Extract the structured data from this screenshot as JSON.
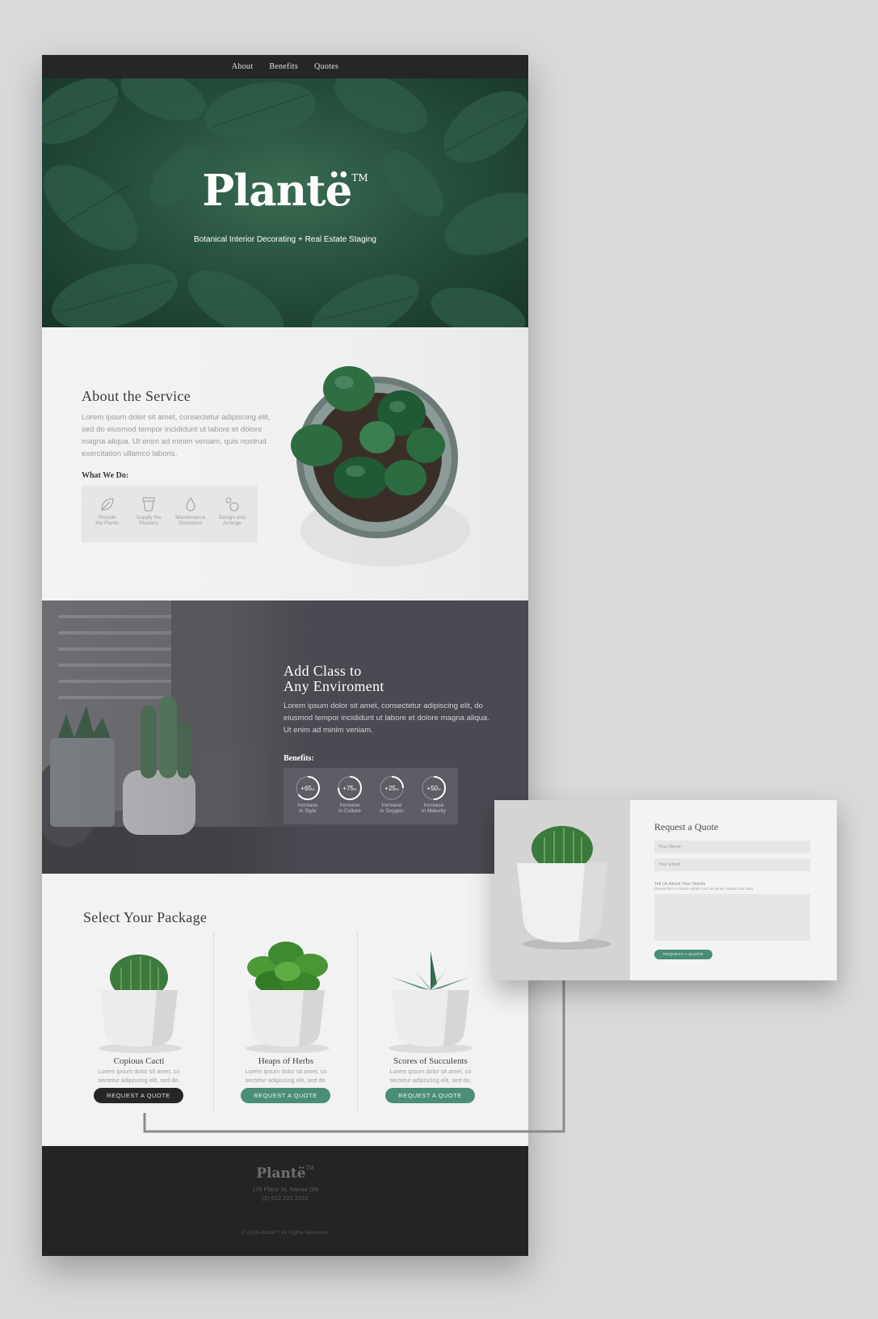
{
  "nav": {
    "items": [
      "About",
      "Benefits",
      "Quotes"
    ]
  },
  "hero": {
    "logo": "Plantë",
    "logo_mark": "TM",
    "tagline": "Botanical Interior Decorating + Real Estate Staging"
  },
  "about": {
    "title": "About the Service",
    "body": "Lorem ipsum dolor sit amet, consectetur adipiscing elit, sed do eiusmod tempor incididunt ut labore et dolore magna aliqua. Ut enim ad minim veniam, quis nostrud exercitation ullamco laboris.",
    "subtitle": "What We Do:",
    "services": [
      {
        "line1": "Provide",
        "line2": "the Plants",
        "icon": "leaf-icon"
      },
      {
        "line1": "Supply the",
        "line2": "Planters",
        "icon": "planter-icon"
      },
      {
        "line1": "Maintenance",
        "line2": "Directions",
        "icon": "water-drop-icon"
      },
      {
        "line1": "Design and",
        "line2": "Arrange",
        "icon": "arrange-icon"
      }
    ]
  },
  "classy": {
    "title_line1": "Add Class to",
    "title_line2": "Any Enviroment",
    "body": "Lorem ipsum dolor sit amet, consectetur adipiscing elit, do eiusmod tempor incididunt ut labore et dolore magna aliqua. Ut enim ad minim veniam.",
    "subtitle": "Benefits:",
    "benefits": [
      {
        "value": "+65",
        "unit": "%",
        "percent": 65,
        "line1": "Increase",
        "line2": "in Style"
      },
      {
        "value": "+75",
        "unit": "%",
        "percent": 75,
        "line1": "Increase",
        "line2": "in Culture"
      },
      {
        "value": "+25",
        "unit": "%",
        "percent": 25,
        "line1": "Increase",
        "line2": "in Oxygen"
      },
      {
        "value": "+50",
        "unit": "%",
        "percent": 50,
        "line1": "Increase",
        "line2": "in Maturity"
      }
    ]
  },
  "packages": {
    "title": "Select Your Package",
    "items": [
      {
        "name": "Copious Cacti",
        "desc1": "Lorem ipsum dolor sit amet, co",
        "desc2": "sectetur adipiscing elit, sed do.",
        "button": "REQUEST A QUOTE",
        "active": true
      },
      {
        "name": "Heaps of Herbs",
        "desc1": "Lorem ipsum dolor sit amet, co",
        "desc2": "sectetur adipiscing elit, sed do.",
        "button": "REQUEST A QUOTE",
        "active": false
      },
      {
        "name": "Scores of Succulents",
        "desc1": "Lorem ipsum dolor sit amet, co",
        "desc2": "sectetur adipiscing elit, sed do.",
        "button": "REQUEST A QUOTE",
        "active": false
      }
    ]
  },
  "footer": {
    "logo": "Plantë",
    "logo_mark": "TM",
    "address": "176 Place St, Narnia ON",
    "phone": "(2) 612.222.2222",
    "copyright": "© 2016 Plantë™ All Rights Reserved."
  },
  "quote": {
    "title": "Request a Quote",
    "name_placeholder": "Your Name",
    "email_placeholder": "Your Email",
    "needs_label": "Tell Us About Your Needs",
    "needs_sub": "(Remember to include details such as venue, budget and date)",
    "button": "REQUEST A QUOTE"
  },
  "colors": {
    "accent": "#4a8d78",
    "dark": "#252626",
    "hero_green": "#27503d",
    "slate": "#4b4951"
  }
}
